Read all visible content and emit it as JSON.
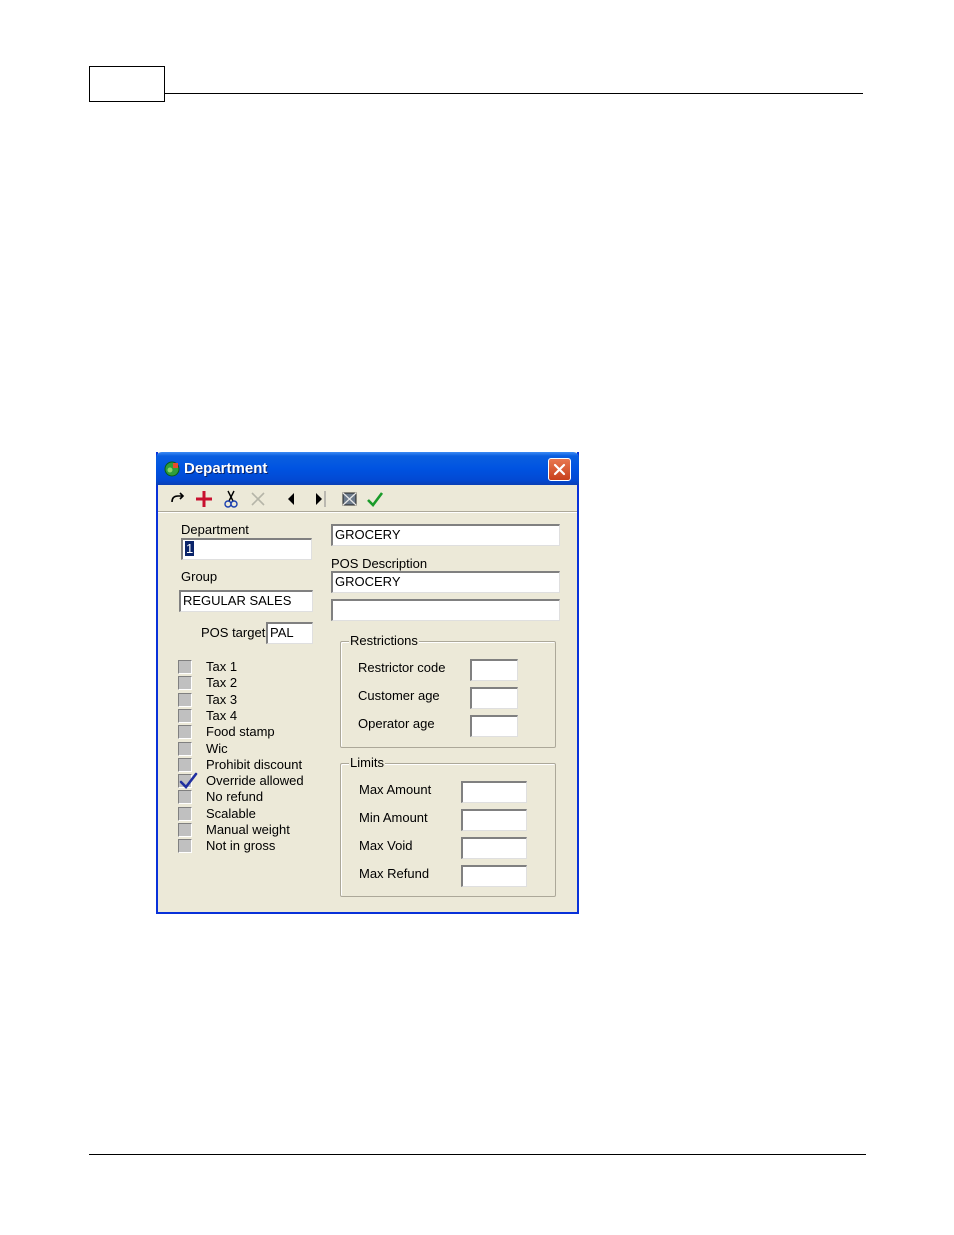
{
  "window": {
    "title": "Department",
    "accent_color": "#0053e1",
    "close_icon": "close-icon"
  },
  "toolbar": {
    "icons": [
      "redo-icon",
      "add-icon",
      "cut-icon",
      "delete-icon",
      "previous-icon",
      "next-icon",
      "refresh-icon",
      "confirm-icon"
    ]
  },
  "form": {
    "department_label": "Department",
    "department_value": "1",
    "department_name": "GROCERY",
    "group_label": "Group",
    "group_value": "REGULAR SALES",
    "pos_description_label": "POS Description",
    "pos_description_value": "GROCERY",
    "pos_description_line2": "",
    "pos_target_label": "POS target",
    "pos_target_value": "PAL"
  },
  "options": [
    {
      "label": "Tax 1",
      "checked": false
    },
    {
      "label": "Tax 2",
      "checked": false
    },
    {
      "label": "Tax 3",
      "checked": false
    },
    {
      "label": "Tax 4",
      "checked": false
    },
    {
      "label": "Food stamp",
      "checked": false
    },
    {
      "label": "Wic",
      "checked": false
    },
    {
      "label": "Prohibit discount",
      "checked": false
    },
    {
      "label": "Override allowed",
      "checked": true
    },
    {
      "label": "No refund",
      "checked": false
    },
    {
      "label": "Scalable",
      "checked": false
    },
    {
      "label": "Manual weight",
      "checked": false
    },
    {
      "label": "Not in gross",
      "checked": false
    }
  ],
  "restrictions": {
    "title": "Restrictions",
    "fields": [
      {
        "label": "Restrictor code",
        "value": ""
      },
      {
        "label": "Customer age",
        "value": ""
      },
      {
        "label": "Operator age",
        "value": ""
      }
    ]
  },
  "limits": {
    "title": "Limits",
    "fields": [
      {
        "label": "Max Amount",
        "value": ""
      },
      {
        "label": "Min Amount",
        "value": ""
      },
      {
        "label": "Max Void",
        "value": ""
      },
      {
        "label": "Max Refund",
        "value": ""
      }
    ]
  }
}
